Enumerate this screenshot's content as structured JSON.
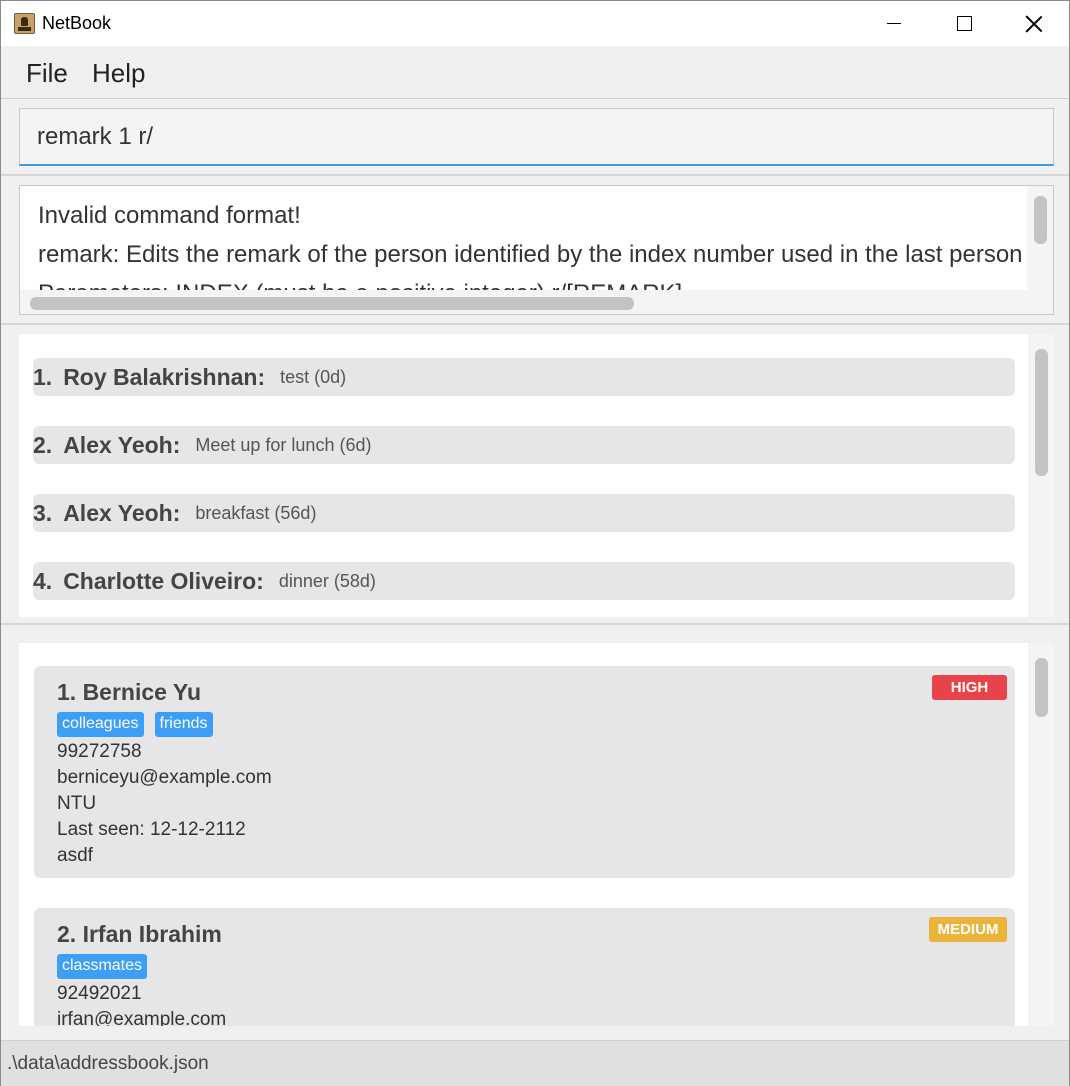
{
  "window": {
    "title": "NetBook",
    "minimize_glyph": "",
    "maximize_glyph": "",
    "close_glyph": ""
  },
  "menu": {
    "file_label": "File",
    "help_label": "Help"
  },
  "command_box": {
    "value": "remark 1 r/"
  },
  "result_display": {
    "lines": [
      "Invalid command format!",
      "remark: Edits the remark of the person identified by the index number used in the last person listing.",
      "Parameters: INDEX (must be a positive integer) r/[REMARK]"
    ]
  },
  "remark_list": {
    "items": [
      {
        "index": "1.",
        "name": "Roy Balakrishnan:",
        "remark": "test (0d)"
      },
      {
        "index": "2.",
        "name": "Alex Yeoh:",
        "remark": "Meet up for lunch (6d)"
      },
      {
        "index": "3.",
        "name": "Alex Yeoh:",
        "remark": "breakfast (56d)"
      },
      {
        "index": "4.",
        "name": "Charlotte Oliveiro:",
        "remark": "dinner (58d)"
      }
    ]
  },
  "person_list": {
    "persons": [
      {
        "title": "1. Bernice Yu",
        "tags": [
          "colleagues",
          "friends"
        ],
        "phone": "99272758",
        "email": "berniceyu@example.com",
        "address": "NTU",
        "last_seen": "Last seen: 12-12-2112",
        "remark": "asdf",
        "priority": "HIGH",
        "priority_color": "#e8424a"
      },
      {
        "title": "2. Irfan Ibrahim",
        "tags": [
          "classmates"
        ],
        "phone": "92492021",
        "email": "irfan@example.com",
        "priority": "MEDIUM",
        "priority_color": "#eab33a"
      }
    ]
  },
  "status_bar": {
    "file_path": ".\\data\\addressbook.json"
  }
}
